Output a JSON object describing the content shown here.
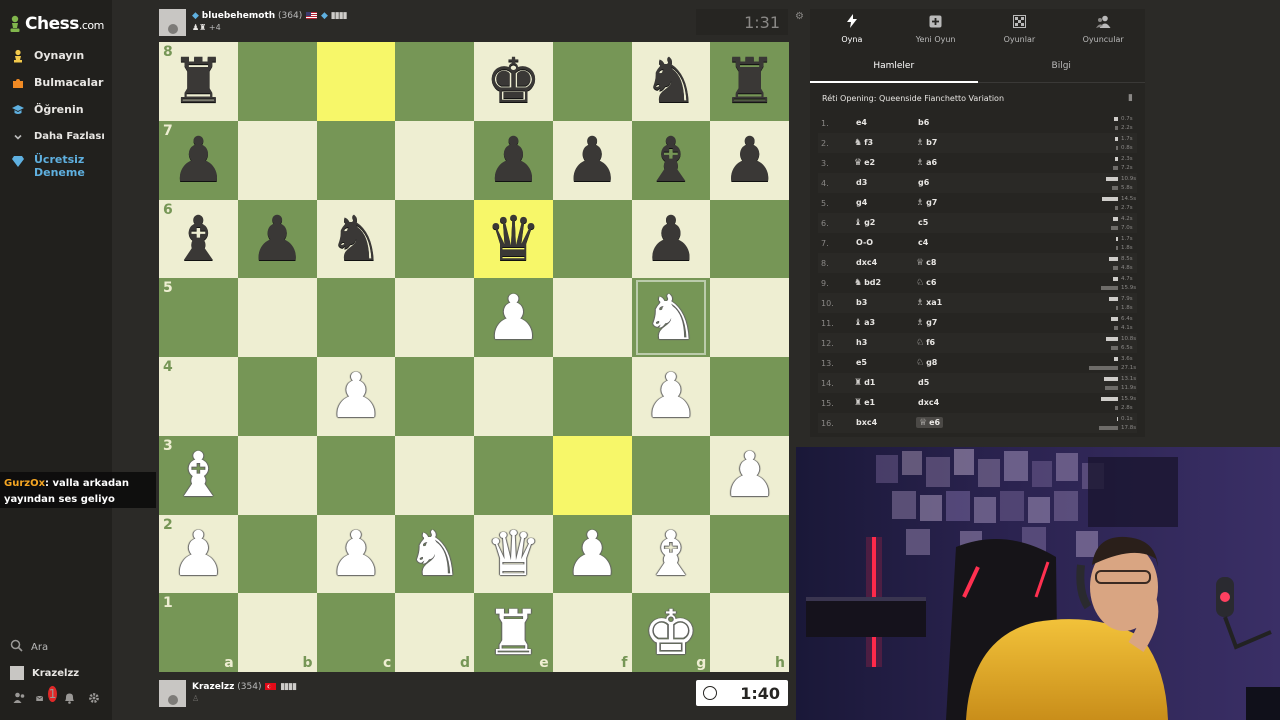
{
  "sidebar": {
    "logo": {
      "text": "Chess",
      "suffix": ".com"
    },
    "items": [
      {
        "label": "Oynayın",
        "icon": "play-icon",
        "color": "#f2c94c"
      },
      {
        "label": "Bulmacalar",
        "icon": "puzzle-icon",
        "color": "#f08a24"
      },
      {
        "label": "Öğrenin",
        "icon": "learn-icon",
        "color": "#5fb0e0"
      },
      {
        "label": "Daha Fazlası",
        "icon": "chevron-down-icon",
        "color": "#bababa"
      },
      {
        "label": "Ücretsiz Deneme",
        "icon": "diamond-icon",
        "color": "#5fb0e0"
      }
    ],
    "search_label": "Ara",
    "user_label": "Krazelzz",
    "notification_count": "1"
  },
  "chat": {
    "user": "GurzOx",
    "message": ": valla arkadan yayından ses geliyo"
  },
  "top_player": {
    "name": "bluebehemoth",
    "rating": "(364)",
    "captured": "+4",
    "clock": "1:31"
  },
  "bottom_player": {
    "name": "Krazelzz",
    "rating": "(354)",
    "clock": "1:40"
  },
  "board": {
    "ranks": [
      "8",
      "7",
      "6",
      "5",
      "4",
      "3",
      "2",
      "1"
    ],
    "files": [
      "a",
      "b",
      "c",
      "d",
      "e",
      "f",
      "g",
      "h"
    ],
    "highlighted": [
      "c8",
      "e6",
      "f3"
    ],
    "dragging": "g5",
    "pieces": {
      "a8": "bR",
      "e8": "bK",
      "g8": "bN",
      "h8": "bR",
      "a7": "bP",
      "e7": "bP",
      "f7": "bP",
      "g7": "bB",
      "h7": "bP",
      "a6": "bB",
      "b6": "bP",
      "c6": "bN",
      "e6": "bQ",
      "g6": "bP",
      "e5": "wP",
      "g5": "wN",
      "c4": "wP",
      "g4": "wP",
      "a3": "wB",
      "h3": "wP",
      "a2": "wP",
      "c2": "wP",
      "d2": "wN",
      "e2": "wQ",
      "f2": "wP",
      "g2": "wB",
      "e1": "wR",
      "g1": "wK"
    }
  },
  "panel": {
    "tabs": [
      {
        "label": "Oyna",
        "icon": "lightning-icon"
      },
      {
        "label": "Yeni Oyun",
        "icon": "plus-icon"
      },
      {
        "label": "Oyunlar",
        "icon": "board-icon"
      },
      {
        "label": "Oyuncular",
        "icon": "players-icon"
      }
    ],
    "subtabs": [
      "Hamleler",
      "Bilgi"
    ],
    "opening": "Réti Opening: Queenside Fianchetto Variation",
    "moves": [
      {
        "n": "1.",
        "w": "e4",
        "wp": "",
        "b": "b6",
        "bp": "",
        "wt": "0.7s",
        "bt": "2.2s",
        "ww": 4,
        "bw": 3
      },
      {
        "n": "2.",
        "w": "f3",
        "wp": "♞",
        "b": "b7",
        "bp": "♗",
        "wt": "1.7s",
        "bt": "0.8s",
        "ww": 3,
        "bw": 2
      },
      {
        "n": "3.",
        "w": "e2",
        "wp": "♛",
        "b": "a6",
        "bp": "♗",
        "wt": "2.3s",
        "bt": "7.2s",
        "ww": 3,
        "bw": 5
      },
      {
        "n": "4.",
        "w": "d3",
        "wp": "",
        "b": "g6",
        "bp": "",
        "wt": "10.9s",
        "bt": "5.8s",
        "ww": 12,
        "bw": 6
      },
      {
        "n": "5.",
        "w": "g4",
        "wp": "",
        "b": "g7",
        "bp": "♗",
        "wt": "14.5s",
        "bt": "2.7s",
        "ww": 16,
        "bw": 3
      },
      {
        "n": "6.",
        "w": "g2",
        "wp": "♝",
        "b": "c5",
        "bp": "",
        "wt": "4.2s",
        "bt": "7.0s",
        "ww": 5,
        "bw": 7
      },
      {
        "n": "7.",
        "w": "O-O",
        "wp": "",
        "b": "c4",
        "bp": "",
        "wt": "1.7s",
        "bt": "1.8s",
        "ww": 2,
        "bw": 2
      },
      {
        "n": "8.",
        "w": "dxc4",
        "wp": "",
        "b": "c8",
        "bp": "♕",
        "wt": "8.5s",
        "bt": "4.8s",
        "ww": 9,
        "bw": 5
      },
      {
        "n": "9.",
        "w": "bd2",
        "wp": "♞",
        "b": "c6",
        "bp": "♘",
        "wt": "4.7s",
        "bt": "15.9s",
        "ww": 5,
        "bw": 17
      },
      {
        "n": "10.",
        "w": "b3",
        "wp": "",
        "b": "xa1",
        "bp": "♗",
        "wt": "7.9s",
        "bt": "1.8s",
        "ww": 9,
        "bw": 2
      },
      {
        "n": "11.",
        "w": "a3",
        "wp": "♝",
        "b": "g7",
        "bp": "♗",
        "wt": "6.4s",
        "bt": "4.1s",
        "ww": 7,
        "bw": 4
      },
      {
        "n": "12.",
        "w": "h3",
        "wp": "",
        "b": "f6",
        "bp": "♘",
        "wt": "10.8s",
        "bt": "6.5s",
        "ww": 12,
        "bw": 7
      },
      {
        "n": "13.",
        "w": "e5",
        "wp": "",
        "b": "g8",
        "bp": "♘",
        "wt": "3.6s",
        "bt": "27.1s",
        "ww": 4,
        "bw": 29
      },
      {
        "n": "14.",
        "w": "d1",
        "wp": "♜",
        "b": "d5",
        "bp": "",
        "wt": "13.1s",
        "bt": "11.9s",
        "ww": 14,
        "bw": 13
      },
      {
        "n": "15.",
        "w": "e1",
        "wp": "♜",
        "b": "dxc4",
        "bp": "",
        "wt": "15.9s",
        "bt": "2.8s",
        "ww": 17,
        "bw": 3
      },
      {
        "n": "16.",
        "w": "bxc4",
        "wp": "",
        "b": "e6",
        "bp": "♕",
        "wt": "0.1s",
        "bt": "17.8s",
        "ww": 1,
        "bw": 19
      }
    ]
  },
  "colors": {
    "light_square": "#eeeed2",
    "dark_square": "#769656",
    "highlight_light": "#f7f769",
    "highlight_dark": "#bbcb2b",
    "background": "#2b2a27"
  }
}
